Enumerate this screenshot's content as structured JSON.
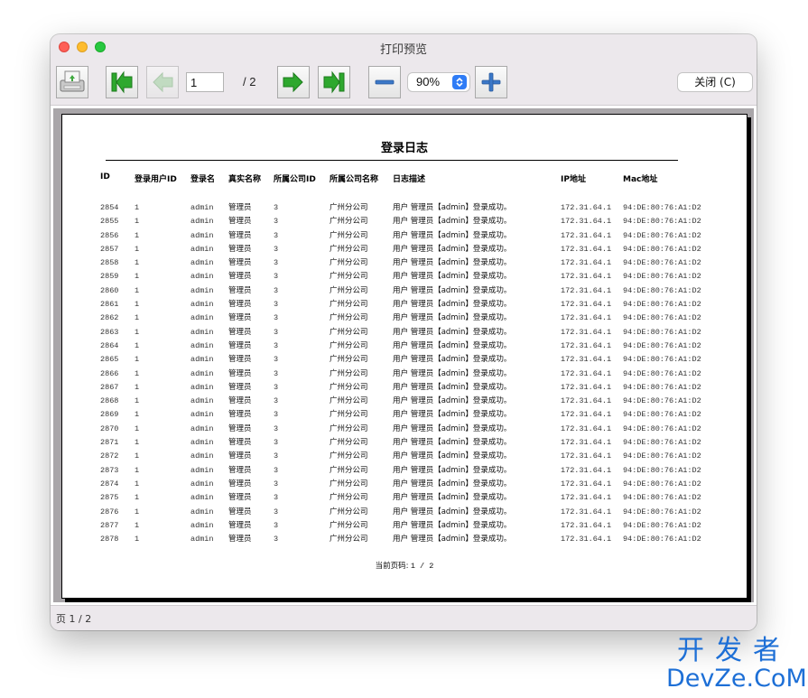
{
  "window": {
    "title": "打印预览"
  },
  "toolbar": {
    "page_current": "1",
    "page_total": "/ 2",
    "zoom_value": "90%",
    "close_label": "关闭 (C)"
  },
  "colors": {
    "arrow_green": "#2ea82e",
    "zoom_blue": "#3b78c8",
    "select_accent": "#2f7cf6",
    "watermark": "#1d6fd6"
  },
  "icons": [
    "print-icon",
    "first-page-icon",
    "prev-page-icon",
    "next-page-icon",
    "last-page-icon",
    "zoom-out-icon",
    "zoom-in-icon",
    "updown-chevron-icon"
  ],
  "report": {
    "title": "登录日志",
    "columns": [
      "ID",
      "登录用户ID",
      "登录名",
      "真实名称",
      "所属公司ID",
      "所属公司名称",
      "日志描述",
      "IP地址",
      "Mac地址"
    ],
    "rows": [
      [
        "2854",
        "1",
        "admin",
        "管理员",
        "3",
        "广州分公司",
        "用户 管理员【admin】登录成功。",
        "172.31.64.1",
        "94:DE:80:76:A1:D2"
      ],
      [
        "2855",
        "1",
        "admin",
        "管理员",
        "3",
        "广州分公司",
        "用户 管理员【admin】登录成功。",
        "172.31.64.1",
        "94:DE:80:76:A1:D2"
      ],
      [
        "2856",
        "1",
        "admin",
        "管理员",
        "3",
        "广州分公司",
        "用户 管理员【admin】登录成功。",
        "172.31.64.1",
        "94:DE:80:76:A1:D2"
      ],
      [
        "2857",
        "1",
        "admin",
        "管理员",
        "3",
        "广州分公司",
        "用户 管理员【admin】登录成功。",
        "172.31.64.1",
        "94:DE:80:76:A1:D2"
      ],
      [
        "2858",
        "1",
        "admin",
        "管理员",
        "3",
        "广州分公司",
        "用户 管理员【admin】登录成功。",
        "172.31.64.1",
        "94:DE:80:76:A1:D2"
      ],
      [
        "2859",
        "1",
        "admin",
        "管理员",
        "3",
        "广州分公司",
        "用户 管理员【admin】登录成功。",
        "172.31.64.1",
        "94:DE:80:76:A1:D2"
      ],
      [
        "2860",
        "1",
        "admin",
        "管理员",
        "3",
        "广州分公司",
        "用户 管理员【admin】登录成功。",
        "172.31.64.1",
        "94:DE:80:76:A1:D2"
      ],
      [
        "2861",
        "1",
        "admin",
        "管理员",
        "3",
        "广州分公司",
        "用户 管理员【admin】登录成功。",
        "172.31.64.1",
        "94:DE:80:76:A1:D2"
      ],
      [
        "2862",
        "1",
        "admin",
        "管理员",
        "3",
        "广州分公司",
        "用户 管理员【admin】登录成功。",
        "172.31.64.1",
        "94:DE:80:76:A1:D2"
      ],
      [
        "2863",
        "1",
        "admin",
        "管理员",
        "3",
        "广州分公司",
        "用户 管理员【admin】登录成功。",
        "172.31.64.1",
        "94:DE:80:76:A1:D2"
      ],
      [
        "2864",
        "1",
        "admin",
        "管理员",
        "3",
        "广州分公司",
        "用户 管理员【admin】登录成功。",
        "172.31.64.1",
        "94:DE:80:76:A1:D2"
      ],
      [
        "2865",
        "1",
        "admin",
        "管理员",
        "3",
        "广州分公司",
        "用户 管理员【admin】登录成功。",
        "172.31.64.1",
        "94:DE:80:76:A1:D2"
      ],
      [
        "2866",
        "1",
        "admin",
        "管理员",
        "3",
        "广州分公司",
        "用户 管理员【admin】登录成功。",
        "172.31.64.1",
        "94:DE:80:76:A1:D2"
      ],
      [
        "2867",
        "1",
        "admin",
        "管理员",
        "3",
        "广州分公司",
        "用户 管理员【admin】登录成功。",
        "172.31.64.1",
        "94:DE:80:76:A1:D2"
      ],
      [
        "2868",
        "1",
        "admin",
        "管理员",
        "3",
        "广州分公司",
        "用户 管理员【admin】登录成功。",
        "172.31.64.1",
        "94:DE:80:76:A1:D2"
      ],
      [
        "2869",
        "1",
        "admin",
        "管理员",
        "3",
        "广州分公司",
        "用户 管理员【admin】登录成功。",
        "172.31.64.1",
        "94:DE:80:76:A1:D2"
      ],
      [
        "2870",
        "1",
        "admin",
        "管理员",
        "3",
        "广州分公司",
        "用户 管理员【admin】登录成功。",
        "172.31.64.1",
        "94:DE:80:76:A1:D2"
      ],
      [
        "2871",
        "1",
        "admin",
        "管理员",
        "3",
        "广州分公司",
        "用户 管理员【admin】登录成功。",
        "172.31.64.1",
        "94:DE:80:76:A1:D2"
      ],
      [
        "2872",
        "1",
        "admin",
        "管理员",
        "3",
        "广州分公司",
        "用户 管理员【admin】登录成功。",
        "172.31.64.1",
        "94:DE:80:76:A1:D2"
      ],
      [
        "2873",
        "1",
        "admin",
        "管理员",
        "3",
        "广州分公司",
        "用户 管理员【admin】登录成功。",
        "172.31.64.1",
        "94:DE:80:76:A1:D2"
      ],
      [
        "2874",
        "1",
        "admin",
        "管理员",
        "3",
        "广州分公司",
        "用户 管理员【admin】登录成功。",
        "172.31.64.1",
        "94:DE:80:76:A1:D2"
      ],
      [
        "2875",
        "1",
        "admin",
        "管理员",
        "3",
        "广州分公司",
        "用户 管理员【admin】登录成功。",
        "172.31.64.1",
        "94:DE:80:76:A1:D2"
      ],
      [
        "2876",
        "1",
        "admin",
        "管理员",
        "3",
        "广州分公司",
        "用户 管理员【admin】登录成功。",
        "172.31.64.1",
        "94:DE:80:76:A1:D2"
      ],
      [
        "2877",
        "1",
        "admin",
        "管理员",
        "3",
        "广州分公司",
        "用户 管理员【admin】登录成功。",
        "172.31.64.1",
        "94:DE:80:76:A1:D2"
      ],
      [
        "2878",
        "1",
        "admin",
        "管理员",
        "3",
        "广州分公司",
        "用户 管理员【admin】登录成功。",
        "172.31.64.1",
        "94:DE:80:76:A1:D2"
      ]
    ],
    "footer_label": "当前页码:",
    "footer_value": "1 / 2"
  },
  "status": {
    "text": "页 1 / 2"
  },
  "watermark": {
    "cn": "开发者",
    "en": "DevZe.CoM"
  }
}
